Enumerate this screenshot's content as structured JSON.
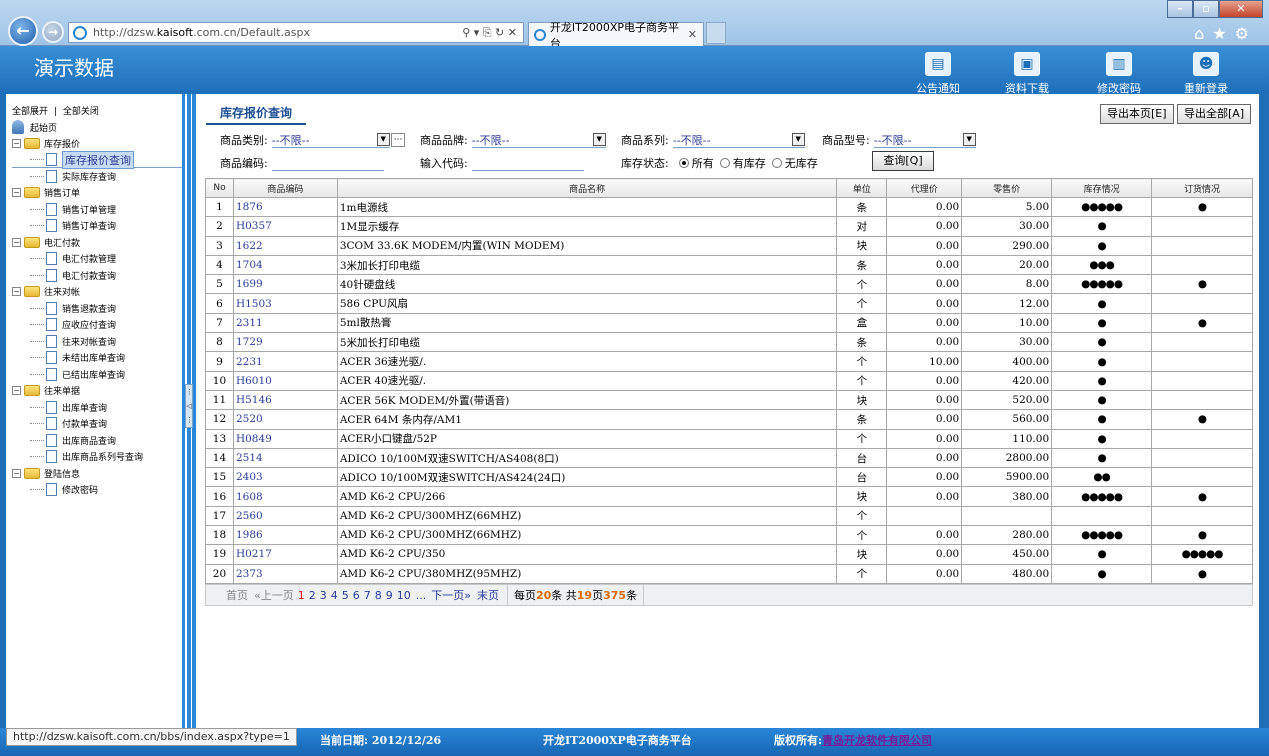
{
  "browser": {
    "url_host": "dzsw.",
    "url_bold": "kaisoft",
    "url_rest": ".com.cn/Default.aspx",
    "url_prefix": "http://",
    "tab_title": "开龙IT2000XP电子商务平台",
    "status_url": "http://dzsw.kaisoft.com.cn/bbs/index.aspx?type=1"
  },
  "header": {
    "title": "演示数据",
    "buttons": [
      "公告通知",
      "资料下载",
      "修改密码",
      "重新登录"
    ]
  },
  "sidebar": {
    "expand_all": "全部展开",
    "divider": "|",
    "collapse_all": "全部关闭",
    "home": "起始页",
    "groups": [
      {
        "label": "库存报价",
        "items": [
          "库存报价查询",
          "实际库存查询"
        ]
      },
      {
        "label": "销售订单",
        "items": [
          "销售订单管理",
          "销售订单查询"
        ]
      },
      {
        "label": "电汇付款",
        "items": [
          "电汇付款管理",
          "电汇付款查询"
        ]
      },
      {
        "label": "往来对帐",
        "items": [
          "销售退款查询",
          "应收应付查询",
          "往来对帐查询",
          "未结出库单查询",
          "已结出库单查询"
        ]
      },
      {
        "label": "往来单据",
        "items": [
          "出库单查询",
          "付款单查询",
          "出库商品查询",
          "出库商品系列号查询"
        ]
      },
      {
        "label": "登陆信息",
        "items": [
          "修改密码"
        ]
      }
    ]
  },
  "main": {
    "page_title": "库存报价查询",
    "export_page": "导出本页[E]",
    "export_all": "导出全部[A]",
    "filters": {
      "category_label": "商品类别:",
      "category_value": "--不限--",
      "brand_label": "商品品牌:",
      "brand_value": "--不限--",
      "series_label": "商品系列:",
      "series_value": "--不限--",
      "model_label": "商品型号:",
      "model_value": "--不限--",
      "code_label": "商品编码:",
      "input_code_label": "输入代码:",
      "stock_label": "库存状态:",
      "stock_options": [
        "所有",
        "有库存",
        "无库存"
      ],
      "query_button": "查询[Q]",
      "more_button": "···"
    },
    "columns": [
      "No",
      "商品编码",
      "商品名称",
      "单位",
      "代理价",
      "零售价",
      "库存情况",
      "订货情况"
    ],
    "rows": [
      [
        "1",
        "1876",
        "1m电源线",
        "条",
        "0.00",
        "5.00",
        "●●●●●",
        "●"
      ],
      [
        "2",
        "H0357",
        "1M显示缓存",
        "对",
        "0.00",
        "30.00",
        "●",
        ""
      ],
      [
        "3",
        "1622",
        "3COM 33.6K MODEM/内置(WIN MODEM)",
        "块",
        "0.00",
        "290.00",
        "●",
        ""
      ],
      [
        "4",
        "1704",
        "3米加长打印电缆",
        "条",
        "0.00",
        "20.00",
        "●●●",
        ""
      ],
      [
        "5",
        "1699",
        "40针硬盘线",
        "个",
        "0.00",
        "8.00",
        "●●●●●",
        "●"
      ],
      [
        "6",
        "H1503",
        "586 CPU风扇",
        "个",
        "0.00",
        "12.00",
        "●",
        ""
      ],
      [
        "7",
        "2311",
        "5ml散热膏",
        "盒",
        "0.00",
        "10.00",
        "●",
        "●"
      ],
      [
        "8",
        "1729",
        "5米加长打印电缆",
        "条",
        "0.00",
        "30.00",
        "●",
        ""
      ],
      [
        "9",
        "2231",
        "ACER 36速光驱/.",
        "个",
        "10.00",
        "400.00",
        "●",
        ""
      ],
      [
        "10",
        "H6010",
        "ACER 40速光驱/.",
        "个",
        "0.00",
        "420.00",
        "●",
        ""
      ],
      [
        "11",
        "H5146",
        "ACER 56K MODEM/外置(带语音)",
        "块",
        "0.00",
        "520.00",
        "●",
        ""
      ],
      [
        "12",
        "2520",
        "ACER 64M 条内存/AM1",
        "条",
        "0.00",
        "560.00",
        "●",
        "●"
      ],
      [
        "13",
        "H0849",
        "ACER小口键盘/52P",
        "个",
        "0.00",
        "110.00",
        "●",
        ""
      ],
      [
        "14",
        "2514",
        "ADICO 10/100M双速SWITCH/AS408(8口)",
        "台",
        "0.00",
        "2800.00",
        "●",
        ""
      ],
      [
        "15",
        "2403",
        "ADICO 10/100M双速SWITCH/AS424(24口)",
        "台",
        "0.00",
        "5900.00",
        "●●",
        ""
      ],
      [
        "16",
        "1608",
        "AMD K6-2 CPU/266",
        "块",
        "0.00",
        "380.00",
        "●●●●●",
        "●"
      ],
      [
        "17",
        "2560",
        "AMD K6-2 CPU/300MHZ(66MHZ)",
        "个",
        "",
        "",
        "",
        ""
      ],
      [
        "18",
        "1986",
        "AMD K6-2 CPU/300MHZ(66MHZ)",
        "个",
        "0.00",
        "280.00",
        "●●●●●",
        "●"
      ],
      [
        "19",
        "H0217",
        "AMD K6-2 CPU/350",
        "块",
        "0.00",
        "450.00",
        "●",
        "●●●●●"
      ],
      [
        "20",
        "2373",
        "AMD K6-2 CPU/380MHZ(95MHZ)",
        "个",
        "0.00",
        "480.00",
        "●",
        "●"
      ]
    ],
    "pager": {
      "first": "首页",
      "prev": "«上一页",
      "pages": [
        "1",
        "2",
        "3",
        "4",
        "5",
        "6",
        "7",
        "8",
        "9",
        "10"
      ],
      "ellipsis": "...",
      "next": "下一页»",
      "last": "末页",
      "per_page_prefix": "每页",
      "per_page": "20",
      "per_page_suffix": "条 共",
      "total_pages": "19",
      "pages_suffix": "页",
      "total_items": "375",
      "items_suffix": "条"
    }
  },
  "footer": {
    "date": "当前日期: 2012/12/26",
    "platform": "开龙IT2000XP电子商务平台",
    "copyright_label": "版权所有:",
    "copyright_company": "青岛开龙软件有限公司"
  }
}
